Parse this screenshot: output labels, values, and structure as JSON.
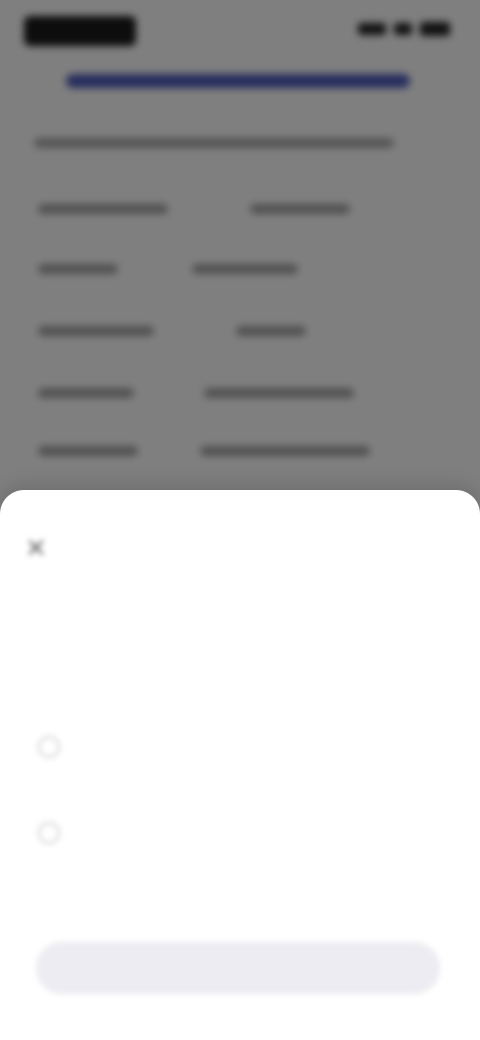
{
  "sheet": {
    "close_icon": "close-icon",
    "title": "",
    "subtitle": "",
    "options": [
      {
        "title": "",
        "description": ""
      },
      {
        "title": "",
        "description": ""
      }
    ],
    "primary_button": ""
  },
  "colors": {
    "scrim": "#000000",
    "link_accent": "#2f3fb0",
    "button_bg": "#ececf2"
  }
}
